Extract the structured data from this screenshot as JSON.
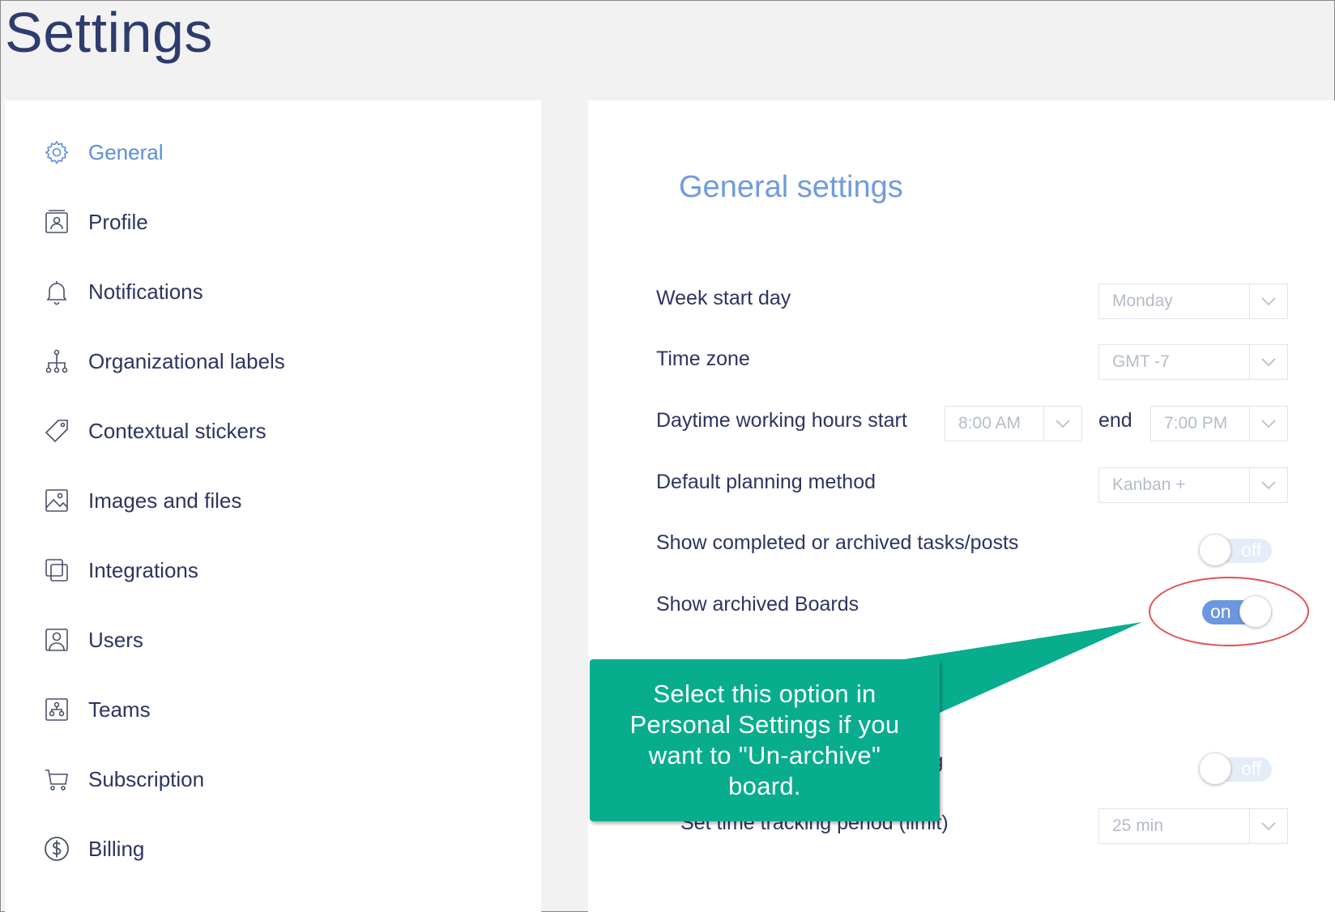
{
  "page_title": "Settings",
  "sidebar": {
    "items": [
      {
        "label": "General",
        "icon": "gear-icon",
        "active": true
      },
      {
        "label": "Profile",
        "icon": "profile-card-icon"
      },
      {
        "label": "Notifications",
        "icon": "bell-icon"
      },
      {
        "label": "Organizational labels",
        "icon": "hierarchy-icon"
      },
      {
        "label": "Contextual stickers",
        "icon": "tag-icon"
      },
      {
        "label": "Images and files",
        "icon": "image-icon"
      },
      {
        "label": "Integrations",
        "icon": "integrations-icon"
      },
      {
        "label": "Users",
        "icon": "user-icon"
      },
      {
        "label": "Teams",
        "icon": "team-icon"
      },
      {
        "label": "Subscription",
        "icon": "cart-icon"
      },
      {
        "label": "Billing",
        "icon": "dollar-circle-icon"
      }
    ]
  },
  "main": {
    "title": "General settings",
    "week_start": {
      "label": "Week start day",
      "value": "Monday"
    },
    "time_zone": {
      "label": "Time zone",
      "value": "GMT -7"
    },
    "working_hours": {
      "label": "Daytime working hours start",
      "start": "8:00 AM",
      "end_label": "end",
      "end": "7:00 PM"
    },
    "planning_method": {
      "label": "Default planning method",
      "value": "Kanban +"
    },
    "show_completed": {
      "label": "Show completed or archived tasks/posts",
      "state": "off"
    },
    "show_archived_boards": {
      "label": "Show archived Boards",
      "state": "on"
    },
    "time_tracking": {
      "label_visible": "cking",
      "state": "off"
    },
    "tracking_period": {
      "label": "Set time tracking period (limit)",
      "value": "25 min"
    }
  },
  "callout": {
    "text": "Select this option in Personal Settings if you want to \"Un-archive\" board."
  },
  "colors": {
    "accent": "#6f9be0",
    "text": "#2c3560",
    "callout": "#08ad8e",
    "highlight": "#e05050",
    "toggle_on": "#6b97e0"
  }
}
